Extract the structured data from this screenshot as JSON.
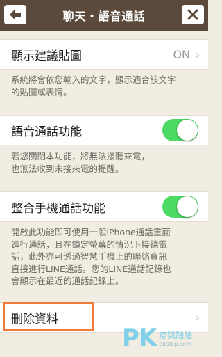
{
  "header": {
    "title": "聊天・語音通話",
    "back_icon": "back-arrow-icon",
    "close_icon": "close-icon"
  },
  "settings": {
    "stickers": {
      "label": "顯示建議貼圖",
      "value": "ON",
      "description_line1": "系統將會依您輸入的文字，顯示適合該文字",
      "description_line2": "的貼圖或表情。"
    },
    "voice_call": {
      "label": "語音通話功能",
      "enabled": true,
      "description_line1": "若您關閉本功能，將無法接聽來電，",
      "description_line2": "也無法收到未接來電的提醒。"
    },
    "integrate_phone": {
      "label": "整合手機通話功能",
      "enabled": true,
      "description_lines": [
        "開啟此功能即可使用一般iPhone通話畫面",
        "進行通話，且在鎖定螢幕的情況下接聽電",
        "話，此外亦可透過智慧手機上的聯絡資訊",
        "直接進行LINE通話。您的LINE通話記錄也",
        "會顯示在最近的通話記錄上。"
      ]
    },
    "delete_data": {
      "label": "刪除資料"
    }
  },
  "watermark": {
    "logo": "PK",
    "text": "痞凱踏踏",
    "url": "pkstep.com"
  },
  "colors": {
    "header_bg": "#5b4a3c",
    "page_bg": "#f1ede2",
    "toggle_on": "#4cd964",
    "highlight": "#f07a3a"
  }
}
